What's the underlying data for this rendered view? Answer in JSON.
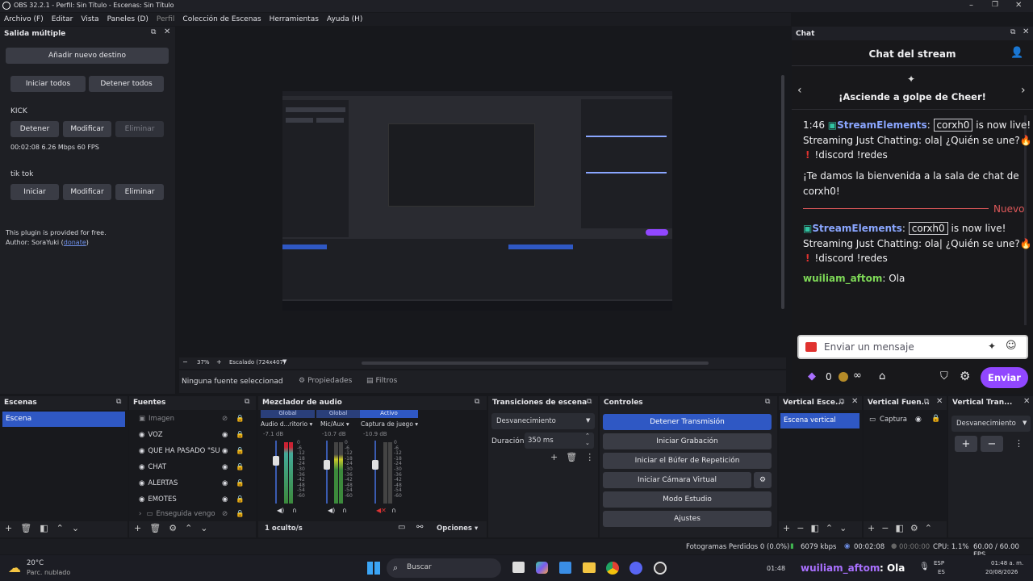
{
  "window": {
    "title": "OBS 32.2.1 - Perfil: Sin Título - Escenas: Sin Título",
    "menu": [
      "Archivo (F)",
      "Editar",
      "Vista",
      "Paneles (D)",
      "Perfil",
      "Colección de Escenas",
      "Herramientas",
      "Ayuda (H)"
    ],
    "controls": [
      "–",
      "❐",
      "✕"
    ]
  },
  "multi_output": {
    "title": "Salida múltiple",
    "add_target": "Añadir nuevo destino",
    "start_all": "Iniciar todos",
    "stop_all": "Detener todos",
    "kick": {
      "name": "KICK",
      "stop": "Detener",
      "edit": "Modificar",
      "remove": "Eliminar",
      "stats": "00:02:08  6.26 Mbps  60 FPS"
    },
    "tiktok": {
      "name": "tik tok",
      "start": "Iniciar",
      "edit": "Modificar",
      "remove": "Eliminar"
    },
    "plugin_note": "This plugin is provided for free.",
    "author_prefix": "Author: SoraYuki (",
    "donate": "donate",
    "author_suffix": ")"
  },
  "preview": {
    "zoom": "37%",
    "scale": "Escalado (724x407)",
    "no_source": "Ninguna fuente seleccionad",
    "properties": "Propiedades",
    "filters": "Filtros"
  },
  "chat": {
    "dock_title": "Chat",
    "title": "Chat del stream",
    "cheer": "¡Asciende a golpe de Cheer!",
    "time": "1:46",
    "bot": "StreamElements",
    "user_tag": "corxh0",
    "live": "is now live!",
    "stream_line": "Streaming Just Chatting: ola| ¿Quién se une?🔥",
    "discord": "!discord !redes",
    "welcome": "¡Te damos la bienvenida a la sala de chat de corxh0!",
    "new": "Nuevo",
    "chatter": "wuiliam_aftom",
    "message": "Ola",
    "input_placeholder": "Enviar un mensaje",
    "points": "0",
    "send": "Enviar"
  },
  "scenes": {
    "title": "Escenas",
    "items": [
      "Escena"
    ]
  },
  "sources": {
    "title": "Fuentes",
    "items": [
      "Imagen",
      "VOZ",
      "QUE HA PASADO \"SUB",
      "CHAT",
      "ALERTAS",
      "EMOTES",
      "Enseguida vengo"
    ]
  },
  "mixer": {
    "title": "Mezclador de audio",
    "channels": [
      {
        "tag": "Global",
        "name": "Audio d...ritorio",
        "db": "-7.1 dB"
      },
      {
        "tag": "Global",
        "name": "Mic/Aux",
        "db": "-10.7 dB"
      },
      {
        "tag": "Activo",
        "name": "Captura de juego",
        "db": "-10.9 dB"
      }
    ],
    "scale": [
      "0",
      "-6",
      "-12",
      "-18",
      "-24",
      "-30",
      "-36",
      "-42",
      "-48",
      "-54",
      "-60"
    ],
    "hidden": "1 oculto/s",
    "options": "Opciones"
  },
  "transitions": {
    "title": "Transiciones de escena",
    "selected": "Desvanecimiento",
    "duration_label": "Duración",
    "duration": "350 ms"
  },
  "controls": {
    "title": "Controles",
    "buttons": [
      "Detener Transmisión",
      "Iniciar Grabación",
      "Iniciar el Búfer de Repetición",
      "Iniciar Cámara Virtual",
      "Modo Estudio",
      "Ajustes"
    ]
  },
  "vertical_scenes": {
    "title": "Vertical Esce...",
    "items": [
      "Escena vertical"
    ]
  },
  "vertical_sources": {
    "title": "Vertical Fuen...",
    "items": [
      "Captura"
    ]
  },
  "vertical_transitions": {
    "title": "Vertical Tran...",
    "selected": "Desvanecimiento"
  },
  "status": {
    "dropped": "Fotogramas Perdidos 0 (0.0%)",
    "kbps": "6079 kbps",
    "live_time": "00:02:08",
    "rec_time": "00:00:00",
    "cpu": "CPU: 1.1%",
    "fps": "60.00 / 60.00 FPS"
  },
  "taskbar": {
    "temp": "20°C",
    "weather": "Parc. nublado",
    "search": "Buscar",
    "clock_left": "01:48",
    "ticker_user": "wuiliam_aftom",
    "ticker_msg": ": Ola",
    "lang": "ESP",
    "region": "ES",
    "time": "01:48 a. m.",
    "date": "20/08/2026"
  },
  "colors": {
    "accent": "#2f58c4",
    "twitch": "#9147ff",
    "bot": "#8aa6ff",
    "chatter": "#7ed957",
    "new": "#e0595a"
  }
}
